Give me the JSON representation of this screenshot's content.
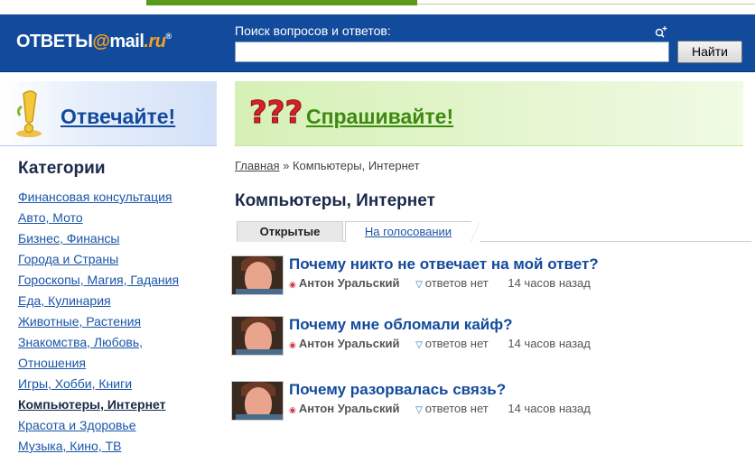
{
  "header": {
    "logo_left": "ОТВЕТЫ",
    "logo_at": "@",
    "logo_mail": "mail",
    "logo_ru": ".ru",
    "logo_reg": "®",
    "search_label": "Поиск вопросов и ответов:",
    "search_value": "",
    "search_button": "Найти"
  },
  "banners": {
    "answer_label": "Отвечайте!",
    "ask_label": "Спрашивайте!"
  },
  "sidebar": {
    "title": "Категории",
    "items": [
      {
        "label": "Финансовая консультация"
      },
      {
        "label": "Авто, Мото"
      },
      {
        "label": "Бизнес, Финансы"
      },
      {
        "label": "Города и Страны"
      },
      {
        "label": "Гороскопы, Магия, Гадания"
      },
      {
        "label": "Еда, Кулинария"
      },
      {
        "label": "Животные, Растения"
      },
      {
        "label": "Знакомства, Любовь,"
      },
      {
        "label": "Отношения"
      },
      {
        "label": "Игры, Хобби, Книги"
      },
      {
        "label": "Компьютеры, Интернет",
        "active": true
      },
      {
        "label": "Красота и Здоровье"
      },
      {
        "label": "Музыка, Кино, ТВ"
      }
    ]
  },
  "breadcrumb": {
    "home": "Главная",
    "separator": "»",
    "current": "Компьютеры, Интернет"
  },
  "page_title": "Компьютеры, Интернет",
  "tabs": {
    "open": "Открытые",
    "voting": "На голосовании"
  },
  "questions": [
    {
      "title": "Почему никто не отвечает на мой ответ?",
      "author": "Антон Уральский",
      "answers": "ответов нет",
      "time": "14 часов назад"
    },
    {
      "title": "Почему мне обломали кайф?",
      "author": "Антон Уральский",
      "answers": "ответов нет",
      "time": "14 часов назад"
    },
    {
      "title": "Почему разорвалась связь?",
      "author": "Антон Уральский",
      "answers": "ответов нет",
      "time": "14 часов назад"
    }
  ],
  "colors": {
    "header_bg": "#124a9c",
    "link": "#1a55a8",
    "ask_green": "#3d8a10",
    "logo_orange": "#f7a21b"
  }
}
